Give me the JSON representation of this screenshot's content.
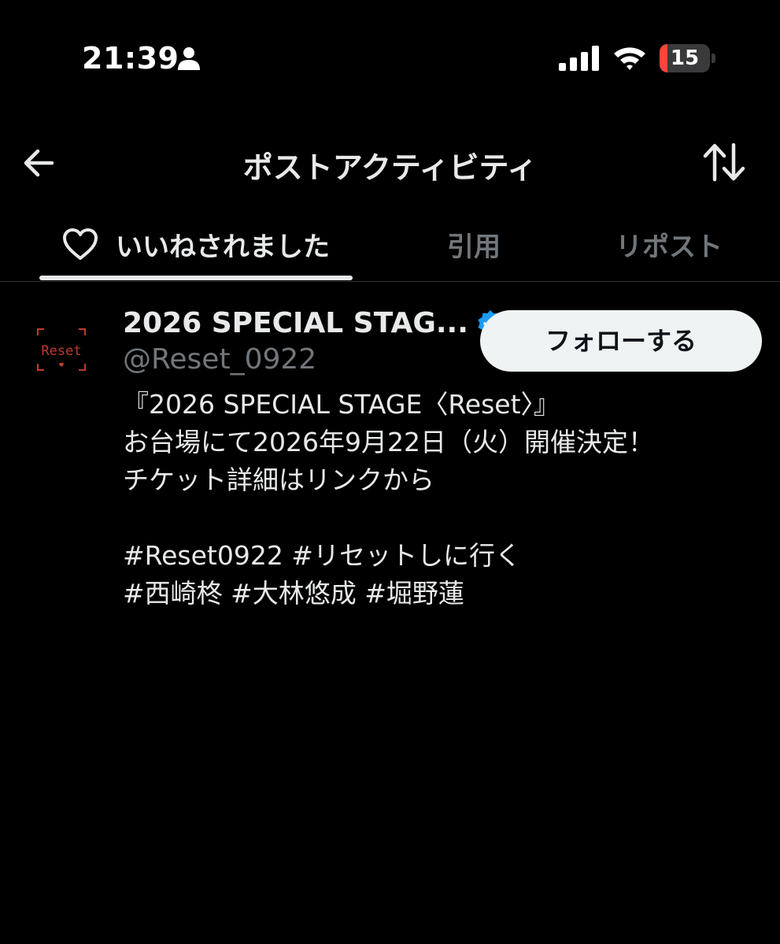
{
  "status_bar": {
    "time": "21:39",
    "battery_level": "15",
    "battery_fraction": 0.15,
    "icons": [
      "person-icon",
      "signal-icon",
      "wifi-icon",
      "battery-icon"
    ]
  },
  "header": {
    "title": "ポストアクティビティ",
    "icons": [
      "back-arrow-icon",
      "sort-arrows-icon"
    ]
  },
  "tabs": [
    {
      "label": "いいねされました",
      "active": true
    },
    {
      "label": "引用",
      "active": false
    },
    {
      "label": "リポスト",
      "active": false
    }
  ],
  "user": {
    "display_name": "2026 SPECIAL STAG...",
    "handle": "@Reset_0922",
    "follow_label": "フォローする",
    "bio": "『2026 SPECIAL STAGE〈Reset〉』\nお台場にて2026年9月22日（火）開催決定！\nチケット詳細はリンクから\n\n#Reset0922 #リセットしに行く\n#西崎柊 #大林悠成 #堀野蓮",
    "avatar_logo_text": "Reset",
    "colors": {
      "verified": "#1d9bf0",
      "avatar_logo": "#c0392b"
    }
  }
}
